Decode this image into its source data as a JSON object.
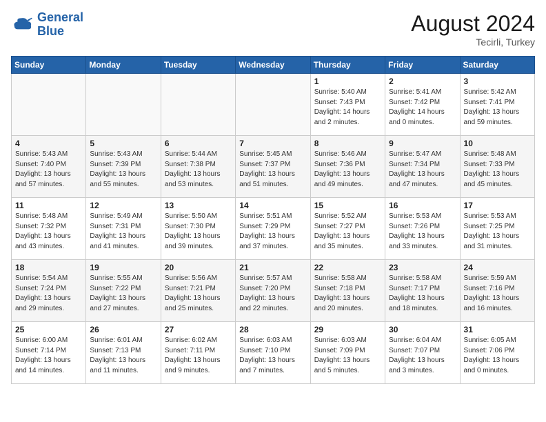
{
  "header": {
    "logo_line1": "General",
    "logo_line2": "Blue",
    "month_year": "August 2024",
    "location": "Tecirli, Turkey"
  },
  "weekdays": [
    "Sunday",
    "Monday",
    "Tuesday",
    "Wednesday",
    "Thursday",
    "Friday",
    "Saturday"
  ],
  "weeks": [
    [
      {
        "num": "",
        "sunrise": "",
        "sunset": "",
        "daylight": "",
        "empty": true
      },
      {
        "num": "",
        "sunrise": "",
        "sunset": "",
        "daylight": "",
        "empty": true
      },
      {
        "num": "",
        "sunrise": "",
        "sunset": "",
        "daylight": "",
        "empty": true
      },
      {
        "num": "",
        "sunrise": "",
        "sunset": "",
        "daylight": "",
        "empty": true
      },
      {
        "num": "1",
        "sunrise": "5:40 AM",
        "sunset": "7:43 PM",
        "daylight": "14 hours and 2 minutes."
      },
      {
        "num": "2",
        "sunrise": "5:41 AM",
        "sunset": "7:42 PM",
        "daylight": "14 hours and 0 minutes."
      },
      {
        "num": "3",
        "sunrise": "5:42 AM",
        "sunset": "7:41 PM",
        "daylight": "13 hours and 59 minutes."
      }
    ],
    [
      {
        "num": "4",
        "sunrise": "5:43 AM",
        "sunset": "7:40 PM",
        "daylight": "13 hours and 57 minutes."
      },
      {
        "num": "5",
        "sunrise": "5:43 AM",
        "sunset": "7:39 PM",
        "daylight": "13 hours and 55 minutes."
      },
      {
        "num": "6",
        "sunrise": "5:44 AM",
        "sunset": "7:38 PM",
        "daylight": "13 hours and 53 minutes."
      },
      {
        "num": "7",
        "sunrise": "5:45 AM",
        "sunset": "7:37 PM",
        "daylight": "13 hours and 51 minutes."
      },
      {
        "num": "8",
        "sunrise": "5:46 AM",
        "sunset": "7:36 PM",
        "daylight": "13 hours and 49 minutes."
      },
      {
        "num": "9",
        "sunrise": "5:47 AM",
        "sunset": "7:34 PM",
        "daylight": "13 hours and 47 minutes."
      },
      {
        "num": "10",
        "sunrise": "5:48 AM",
        "sunset": "7:33 PM",
        "daylight": "13 hours and 45 minutes."
      }
    ],
    [
      {
        "num": "11",
        "sunrise": "5:48 AM",
        "sunset": "7:32 PM",
        "daylight": "13 hours and 43 minutes."
      },
      {
        "num": "12",
        "sunrise": "5:49 AM",
        "sunset": "7:31 PM",
        "daylight": "13 hours and 41 minutes."
      },
      {
        "num": "13",
        "sunrise": "5:50 AM",
        "sunset": "7:30 PM",
        "daylight": "13 hours and 39 minutes."
      },
      {
        "num": "14",
        "sunrise": "5:51 AM",
        "sunset": "7:29 PM",
        "daylight": "13 hours and 37 minutes."
      },
      {
        "num": "15",
        "sunrise": "5:52 AM",
        "sunset": "7:27 PM",
        "daylight": "13 hours and 35 minutes."
      },
      {
        "num": "16",
        "sunrise": "5:53 AM",
        "sunset": "7:26 PM",
        "daylight": "13 hours and 33 minutes."
      },
      {
        "num": "17",
        "sunrise": "5:53 AM",
        "sunset": "7:25 PM",
        "daylight": "13 hours and 31 minutes."
      }
    ],
    [
      {
        "num": "18",
        "sunrise": "5:54 AM",
        "sunset": "7:24 PM",
        "daylight": "13 hours and 29 minutes."
      },
      {
        "num": "19",
        "sunrise": "5:55 AM",
        "sunset": "7:22 PM",
        "daylight": "13 hours and 27 minutes."
      },
      {
        "num": "20",
        "sunrise": "5:56 AM",
        "sunset": "7:21 PM",
        "daylight": "13 hours and 25 minutes."
      },
      {
        "num": "21",
        "sunrise": "5:57 AM",
        "sunset": "7:20 PM",
        "daylight": "13 hours and 22 minutes."
      },
      {
        "num": "22",
        "sunrise": "5:58 AM",
        "sunset": "7:18 PM",
        "daylight": "13 hours and 20 minutes."
      },
      {
        "num": "23",
        "sunrise": "5:58 AM",
        "sunset": "7:17 PM",
        "daylight": "13 hours and 18 minutes."
      },
      {
        "num": "24",
        "sunrise": "5:59 AM",
        "sunset": "7:16 PM",
        "daylight": "13 hours and 16 minutes."
      }
    ],
    [
      {
        "num": "25",
        "sunrise": "6:00 AM",
        "sunset": "7:14 PM",
        "daylight": "13 hours and 14 minutes."
      },
      {
        "num": "26",
        "sunrise": "6:01 AM",
        "sunset": "7:13 PM",
        "daylight": "13 hours and 11 minutes."
      },
      {
        "num": "27",
        "sunrise": "6:02 AM",
        "sunset": "7:11 PM",
        "daylight": "13 hours and 9 minutes."
      },
      {
        "num": "28",
        "sunrise": "6:03 AM",
        "sunset": "7:10 PM",
        "daylight": "13 hours and 7 minutes."
      },
      {
        "num": "29",
        "sunrise": "6:03 AM",
        "sunset": "7:09 PM",
        "daylight": "13 hours and 5 minutes."
      },
      {
        "num": "30",
        "sunrise": "6:04 AM",
        "sunset": "7:07 PM",
        "daylight": "13 hours and 3 minutes."
      },
      {
        "num": "31",
        "sunrise": "6:05 AM",
        "sunset": "7:06 PM",
        "daylight": "13 hours and 0 minutes."
      }
    ]
  ],
  "labels": {
    "sunrise_prefix": "Sunrise: ",
    "sunset_prefix": "Sunset: ",
    "daylight_prefix": "Daylight: "
  }
}
